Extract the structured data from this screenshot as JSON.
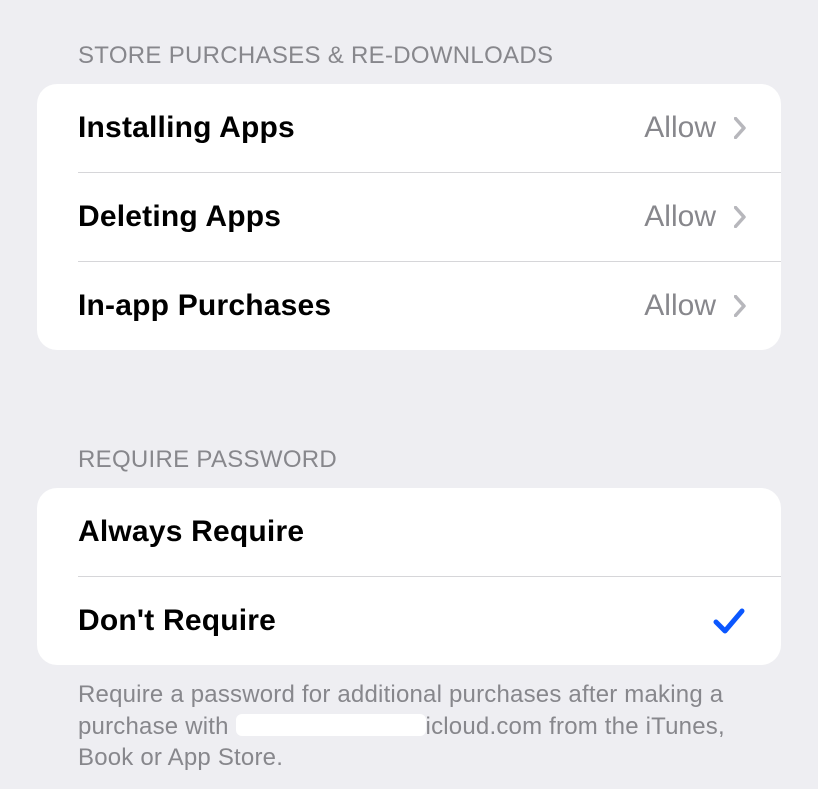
{
  "sections": {
    "store": {
      "header": "Store Purchases & Re-downloads",
      "items": [
        {
          "label": "Installing Apps",
          "value": "Allow"
        },
        {
          "label": "Deleting Apps",
          "value": "Allow"
        },
        {
          "label": "In-app Purchases",
          "value": "Allow"
        }
      ]
    },
    "password": {
      "header": "Require Password",
      "items": [
        {
          "label": "Always Require",
          "selected": false
        },
        {
          "label": "Don't Require",
          "selected": true
        }
      ],
      "footer_prefix": "Require a password for additional purchases after making a purchase with ",
      "footer_redacted": "",
      "footer_domain": "icloud.com",
      "footer_suffix": " from the iTunes, Book or App Store."
    }
  }
}
